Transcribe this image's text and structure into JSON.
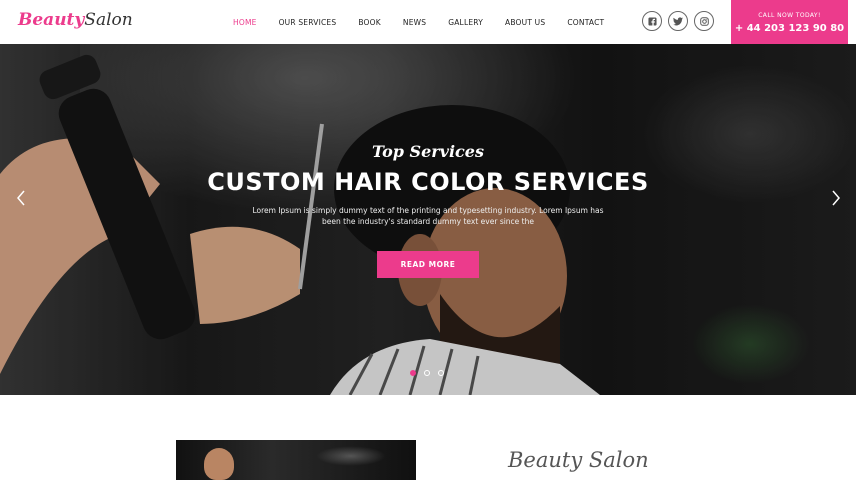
{
  "brand": {
    "logo_part1": "Beauty",
    "logo_part2": "Salon",
    "accent_color": "#ec3b8c"
  },
  "nav": {
    "items": [
      {
        "label": "HOME",
        "active": true
      },
      {
        "label": "OUR SERVICES",
        "active": false
      },
      {
        "label": "BOOK",
        "active": false
      },
      {
        "label": "NEWS",
        "active": false
      },
      {
        "label": "GALLERY",
        "active": false
      },
      {
        "label": "ABOUT US",
        "active": false
      },
      {
        "label": "CONTACT",
        "active": false
      }
    ]
  },
  "social": {
    "icons": [
      "facebook-icon",
      "twitter-icon",
      "instagram-icon"
    ]
  },
  "call": {
    "label": "CALL NOW TODAY!",
    "phone": "+ 44 203 123 90 80"
  },
  "hero": {
    "subtitle": "Top Services",
    "title": "CUSTOM HAIR COLOR SERVICES",
    "description": "Lorem Ipsum is simply dummy text of the printing and typesetting industry. Lorem Ipsum has been the industry's standard dummy text ever since the",
    "button_label": "READ MORE",
    "slides": 3,
    "active_slide": 1
  },
  "about": {
    "title": "Beauty Salon"
  }
}
